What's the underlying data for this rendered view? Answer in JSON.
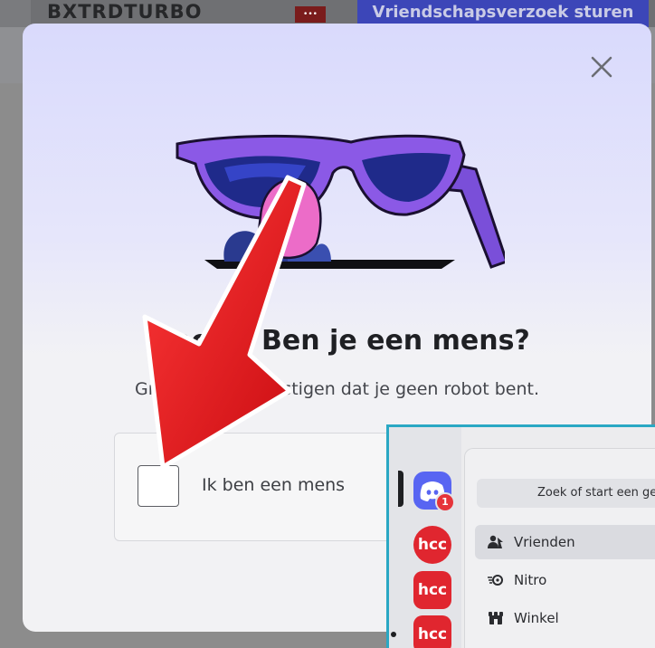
{
  "background": {
    "username": "BXTRDTURBO",
    "more_label": "•••",
    "friend_request_button": "Vriendschapsverzoek sturen"
  },
  "modal": {
    "title": "Wacht! Ben je een mens?",
    "subtitle": "Graag even bevestigen dat je geen robot bent.",
    "checkbox_label": "Ik ben een mens",
    "close_icon": "close-icon",
    "hero_image": "glasses-nose-disguise"
  },
  "discord": {
    "search_placeholder": "Zoek of start een gesprek",
    "notification_count": "1",
    "servers": [
      {
        "label": "hcc"
      },
      {
        "label": "hcc"
      },
      {
        "label": "hcc"
      }
    ],
    "nav": [
      {
        "label": "Vrienden",
        "icon": "friends-icon"
      },
      {
        "label": "Nitro",
        "icon": "nitro-icon"
      },
      {
        "label": "Winkel",
        "icon": "shop-icon"
      }
    ]
  },
  "colors": {
    "arrow": "#e8141a",
    "discord_blurple": "#5865f2",
    "hcc_red": "#e0262f"
  }
}
